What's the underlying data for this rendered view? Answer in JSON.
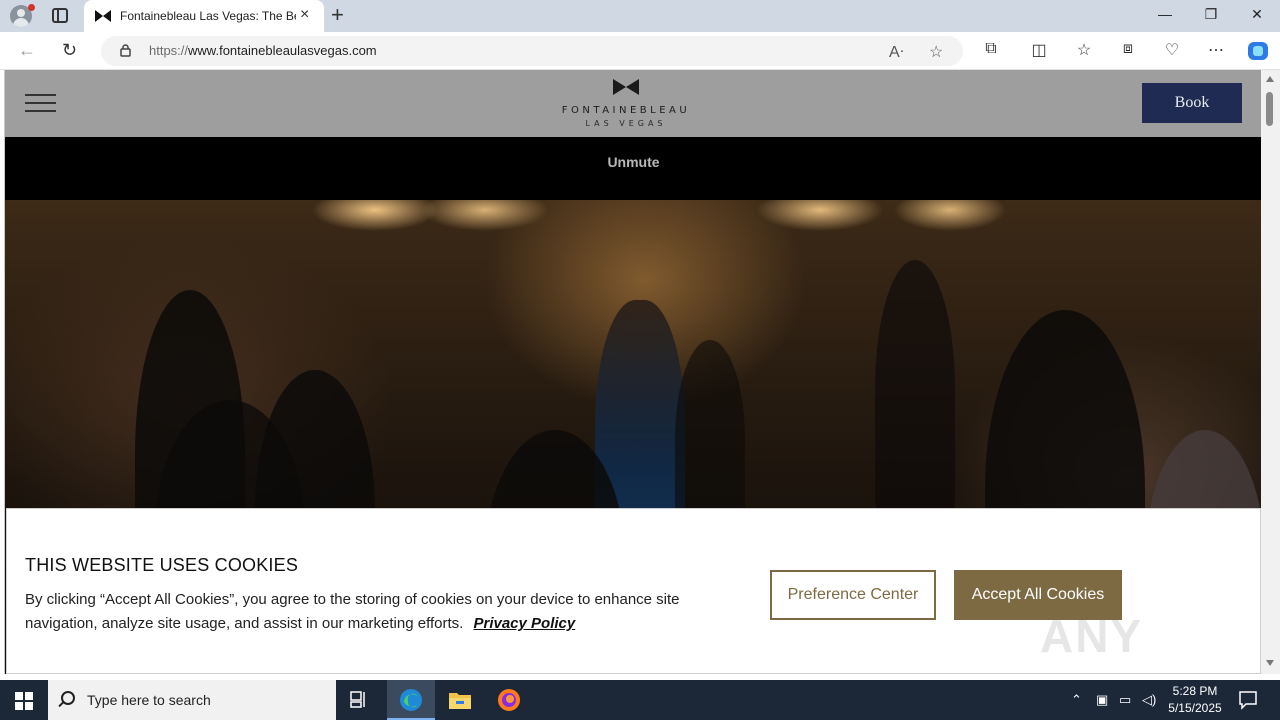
{
  "browser": {
    "tab_title": "Fontainebleau Las Vegas: The Be",
    "url_scheme": "https://",
    "url_host": "www.fontainebleaulasvegas.com",
    "new_tab_symbol": "+",
    "tab_close_symbol": "×",
    "window_controls": {
      "minimize": "—",
      "restore": "❐",
      "close": "✕"
    }
  },
  "site": {
    "logo_name": "FONTAINEBLEAU",
    "logo_sub": "LAS VEGAS",
    "book_label": "Book",
    "unmute_label": "Unmute"
  },
  "cookie_banner": {
    "title": "THIS WEBSITE USES COOKIES",
    "text": "By clicking “Accept All Cookies”, you agree to the storing of cookies on your device to enhance site navigation, analyze site usage, and assist in our marketing efforts.",
    "privacy_link": "Privacy Policy",
    "preference_button": "Preference Center",
    "accept_button": "Accept All Cookies"
  },
  "watermark": "ANY RUN",
  "taskbar": {
    "search_placeholder": "Type here to search",
    "time": "5:28 PM",
    "date": "5/15/2025"
  },
  "colors": {
    "brand_navy": "#1f2b52",
    "cookie_gold": "#7d6a42",
    "header_gray": "#9e9e9e"
  }
}
